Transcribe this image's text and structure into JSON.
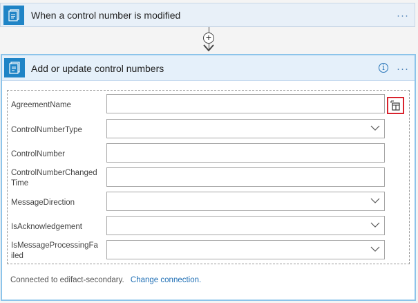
{
  "trigger": {
    "title": "When a control number is modified",
    "icon": "document-stack-icon",
    "more": "···"
  },
  "connector": {
    "add_symbol": "+"
  },
  "action": {
    "title": "Add or update control numbers",
    "icon": "document-stack-icon",
    "info": "i",
    "more": "···",
    "fields": [
      {
        "label": "AgreementName",
        "value": "",
        "type": "text"
      },
      {
        "label": "ControlNumberType",
        "value": "",
        "type": "dropdown"
      },
      {
        "label": "ControlNumber",
        "value": "",
        "type": "text"
      },
      {
        "label": "ControlNumberChangedTime",
        "value": "",
        "type": "text"
      },
      {
        "label": "MessageDirection",
        "value": "",
        "type": "dropdown"
      },
      {
        "label": "IsAcknowledgement",
        "value": "",
        "type": "dropdown"
      },
      {
        "label": "IsMessageProcessingFailed",
        "value": "",
        "type": "dropdown"
      }
    ],
    "connection_text": "Connected to edifact-secondary.",
    "change_connection_label": "Change connection."
  },
  "colors": {
    "accent": "#1f84c6",
    "highlight": "#d9232e",
    "link": "#1f6fb5"
  }
}
